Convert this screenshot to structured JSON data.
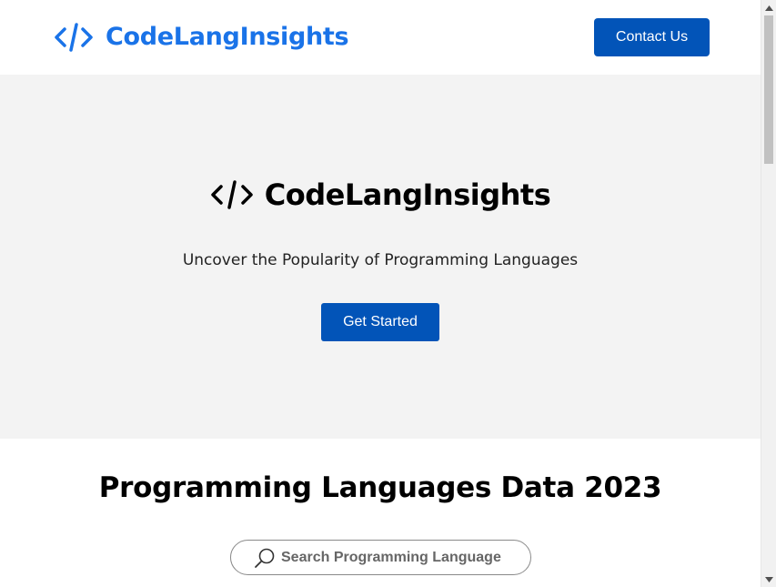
{
  "header": {
    "brand_name": "CodeLangInsights",
    "contact_label": "Contact Us",
    "brand_icon": "code-brackets-icon",
    "brand_color": "#1a73e8"
  },
  "hero": {
    "title": "CodeLangInsights",
    "subtitle": "Uncover the Popularity of Programming Languages",
    "cta_label": "Get Started",
    "background": "#f3f3f3"
  },
  "data_section": {
    "title": "Programming Languages Data 2023",
    "search_placeholder": "Search Programming Language"
  },
  "colors": {
    "button_bg": "#0254b8",
    "button_text": "#ffffff"
  }
}
